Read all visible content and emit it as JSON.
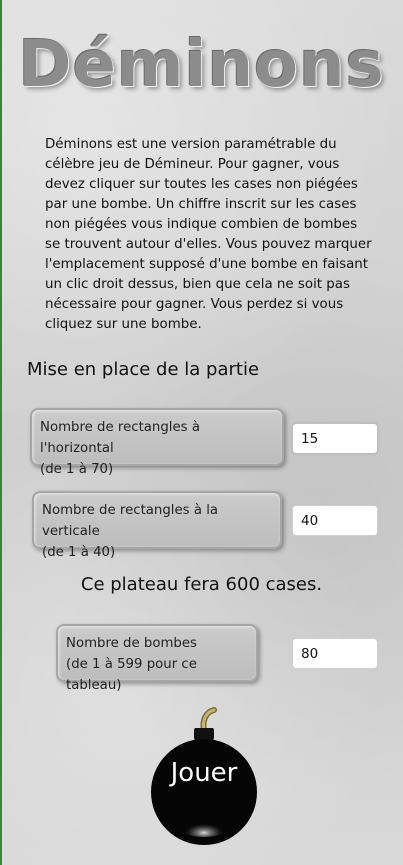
{
  "title": "Déminons",
  "intro": "Déminons est une version paramétrable du célèbre jeu de Démineur. Pour gagner, vous devez cliquer sur toutes les cases non piégées par une bombe. Un chiffre inscrit sur les cases non piégées vous indique combien de bombes se trouvent autour d'elles. Vous pouvez marquer l'emplacement supposé d'une bombe en faisant un clic droit dessus, bien que cela ne soit pas nécessaire pour gagner. Vous perdez si vous cliquez sur une bombe.",
  "setup": {
    "heading": "Mise en place de la partie",
    "horizontal": {
      "label_line1": "Nombre de rectangles à l'horizontal",
      "label_line2": "(de 1 à 70)",
      "value": "15"
    },
    "vertical": {
      "label_line1": "Nombre de rectangles à la verticale",
      "label_line2": "(de 1 à 40)",
      "value": "40"
    },
    "cells_summary": "Ce plateau fera 600 cases.",
    "bombs": {
      "label_line1": "Nombre de bombes",
      "label_line2": "(de 1 à 599 pour ce tableau)",
      "value": "80"
    }
  },
  "play_button": {
    "label": "Jouer",
    "icon": "bomb-icon"
  },
  "colors": {
    "background": "#d6d6d6",
    "title": "#8c8c8c",
    "label_box": "#c4c4c4",
    "bomb": "#000000",
    "fuse": "#b5a36a"
  }
}
